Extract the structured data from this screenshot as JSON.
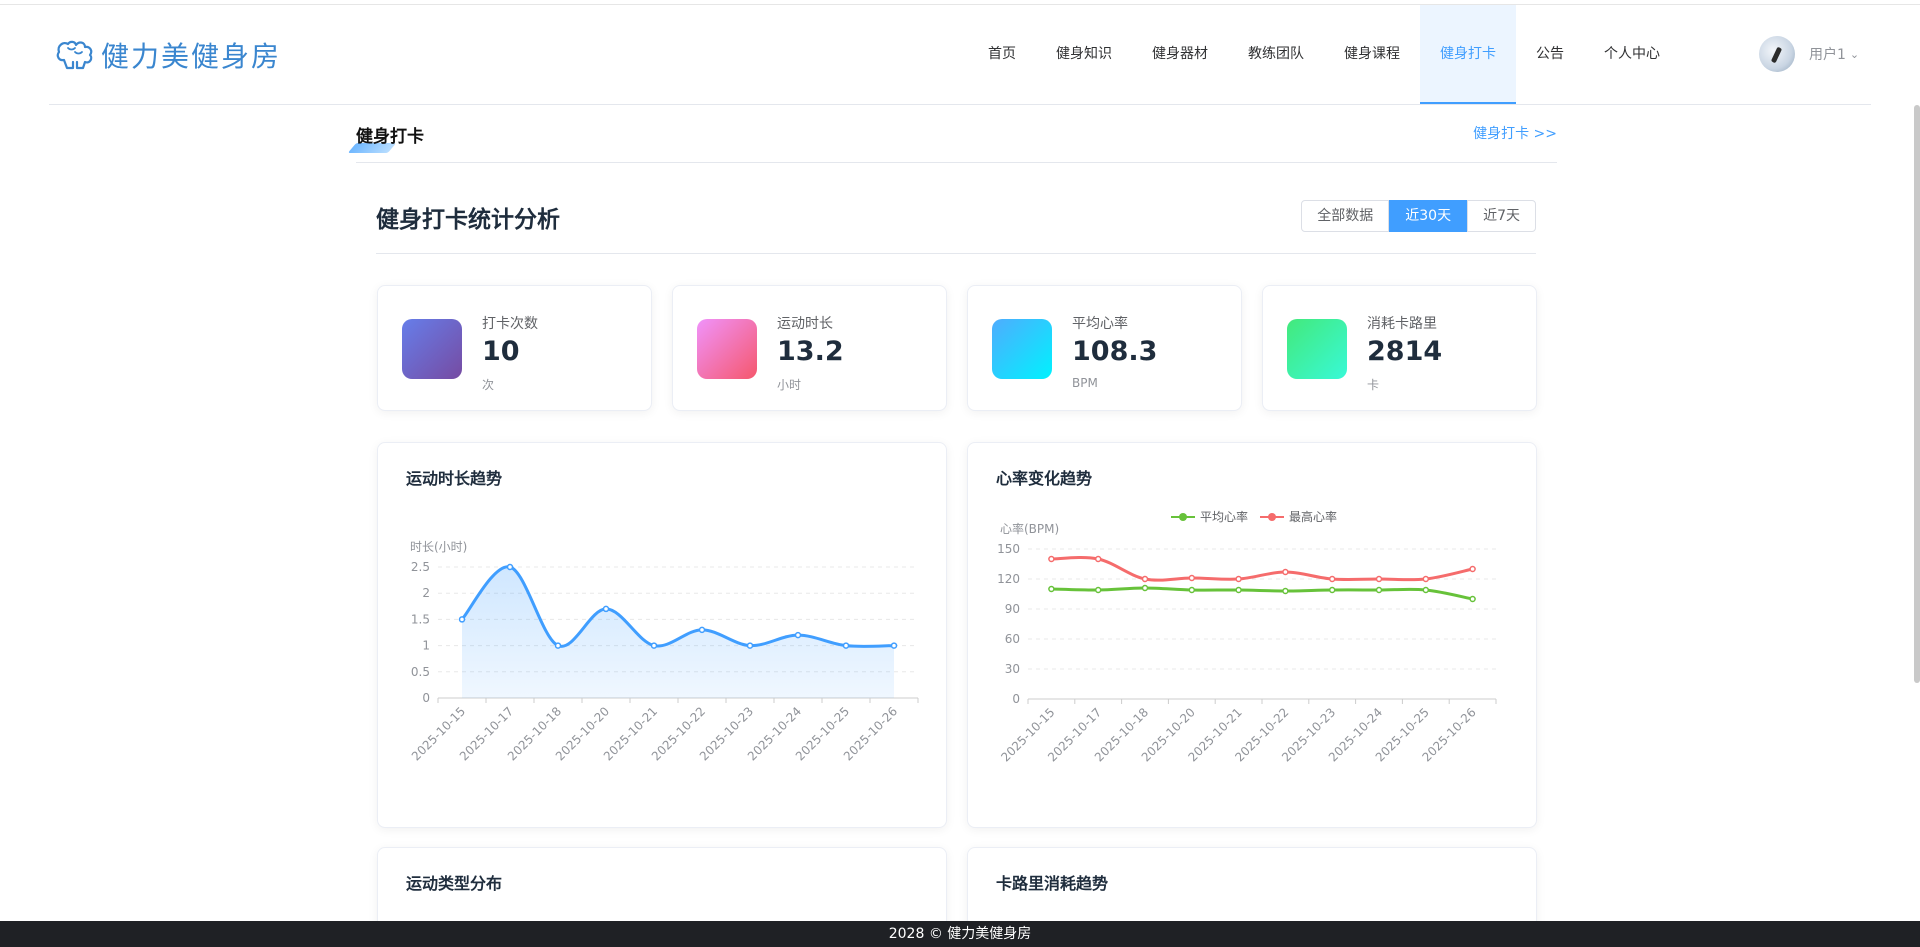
{
  "brand": {
    "name": "健力美健身房"
  },
  "nav": {
    "items": [
      {
        "label": "首页"
      },
      {
        "label": "健身知识"
      },
      {
        "label": "健身器材"
      },
      {
        "label": "教练团队"
      },
      {
        "label": "健身课程"
      },
      {
        "label": "健身打卡",
        "active": true
      },
      {
        "label": "公告"
      },
      {
        "label": "个人中心"
      }
    ]
  },
  "user": {
    "name": "用户1"
  },
  "section": {
    "title": "健身打卡",
    "link": "健身打卡 >>"
  },
  "panel": {
    "title": "健身打卡统计分析",
    "range_buttons": [
      {
        "label": "全部数据"
      },
      {
        "label": "近30天",
        "active": true
      },
      {
        "label": "近7天"
      }
    ]
  },
  "stats": [
    {
      "label": "打卡次数",
      "value": "10",
      "unit": "次",
      "gradient": [
        "#667eea",
        "#764ba2"
      ]
    },
    {
      "label": "运动时长",
      "value": "13.2",
      "unit": "小时",
      "gradient": [
        "#f093fb",
        "#f5576c"
      ]
    },
    {
      "label": "平均心率",
      "value": "108.3",
      "unit": "BPM",
      "gradient": [
        "#4facfe",
        "#00f2fe"
      ]
    },
    {
      "label": "消耗卡路里",
      "value": "2814",
      "unit": "卡",
      "gradient": [
        "#43e97b",
        "#38f9d7"
      ]
    }
  ],
  "cards": {
    "duration": {
      "title": "运动时长趋势"
    },
    "heart": {
      "title": "心率变化趋势"
    },
    "types": {
      "title": "运动类型分布"
    },
    "calories": {
      "title": "卡路里消耗趋势"
    }
  },
  "chart_data": [
    {
      "type": "area",
      "title": "运动时长趋势",
      "ylabel": "时长(小时)",
      "x": [
        "2025-10-15",
        "2025-10-17",
        "2025-10-18",
        "2025-10-20",
        "2025-10-21",
        "2025-10-22",
        "2025-10-23",
        "2025-10-24",
        "2025-10-25",
        "2025-10-26"
      ],
      "values": [
        1.5,
        2.5,
        1.0,
        1.7,
        1.0,
        1.3,
        1.0,
        1.2,
        1.0,
        1.0
      ],
      "ylim": [
        0,
        2.5
      ],
      "yticks": [
        "0",
        "0.5",
        "1",
        "1.5",
        "2",
        "2.5"
      ],
      "color": "#409eff",
      "grid": true
    },
    {
      "type": "line",
      "title": "心率变化趋势",
      "ylabel": "心率(BPM)",
      "x": [
        "2025-10-15",
        "2025-10-17",
        "2025-10-18",
        "2025-10-20",
        "2025-10-21",
        "2025-10-22",
        "2025-10-23",
        "2025-10-24",
        "2025-10-25",
        "2025-10-26"
      ],
      "series": [
        {
          "name": "平均心率",
          "values": [
            110,
            109,
            111,
            109,
            109,
            108,
            109,
            109,
            109,
            100
          ],
          "color": "#67c23a"
        },
        {
          "name": "最高心率",
          "values": [
            140,
            140,
            120,
            121,
            120,
            127,
            120,
            120,
            120,
            130
          ],
          "color": "#f56c6c"
        }
      ],
      "ylim": [
        0,
        150
      ],
      "yticks": [
        "0",
        "30",
        "60",
        "90",
        "120",
        "150"
      ],
      "legend": "top-center",
      "grid": true
    }
  ],
  "footer": {
    "text": "2028 © 健力美健身房"
  }
}
